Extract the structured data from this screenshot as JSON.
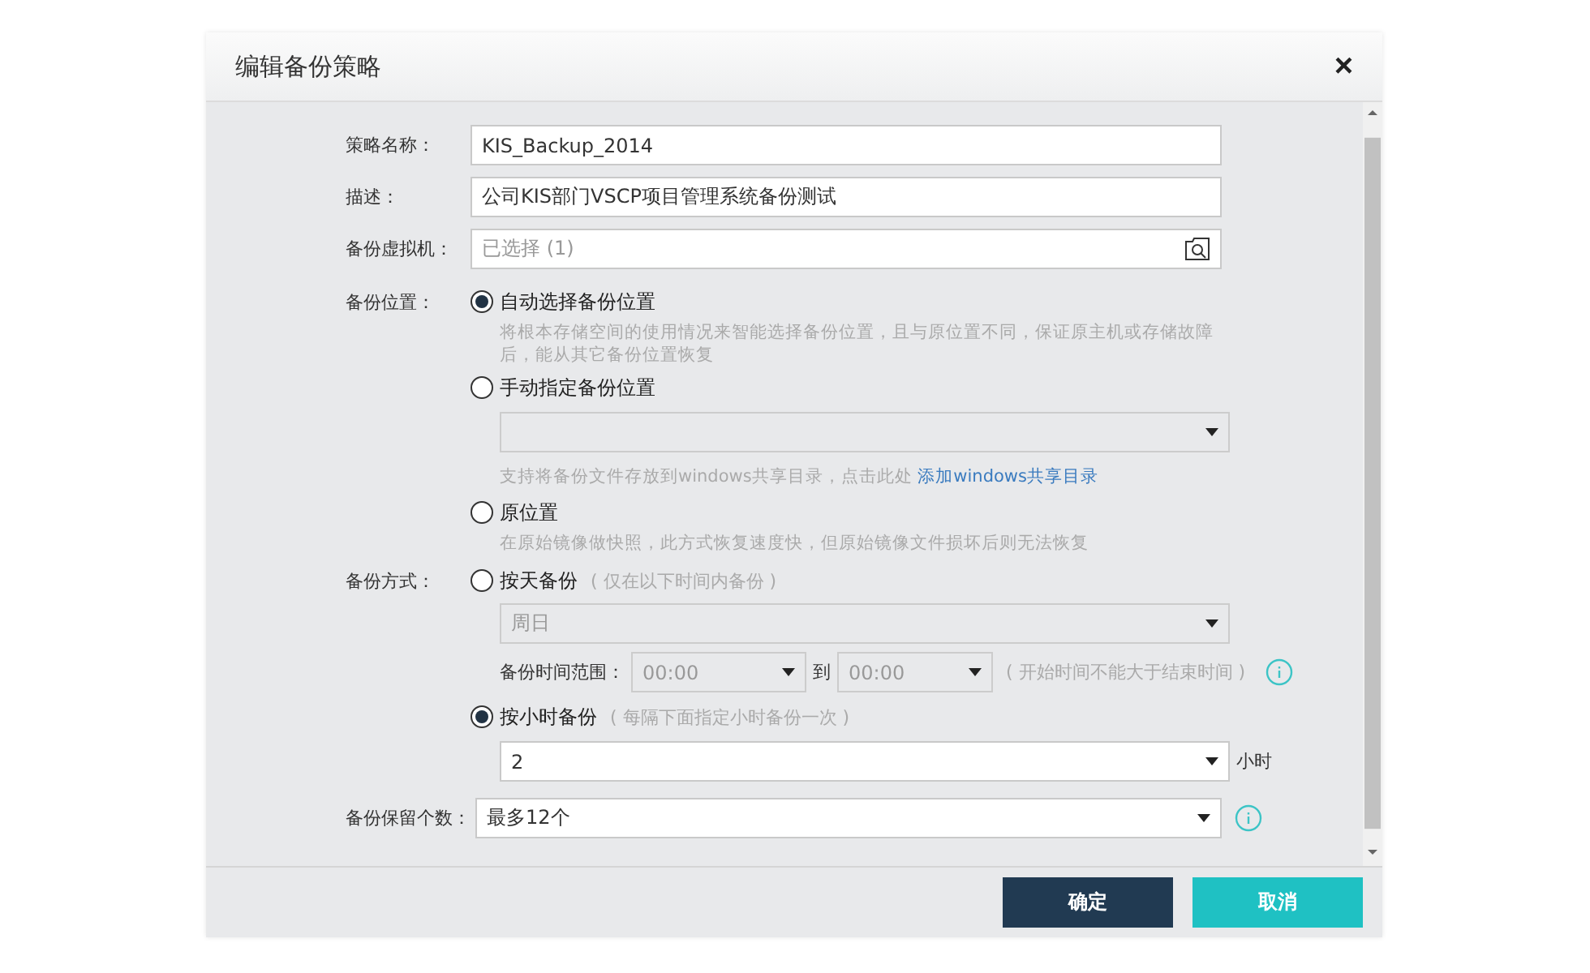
{
  "dialog": {
    "title": "编辑备份策略",
    "close": "×"
  },
  "fields": [
    {
      "kind": "text",
      "label": "策略名称：",
      "value": "KIS_Backup_2014"
    },
    {
      "kind": "text",
      "label": "描述：",
      "value": "公司KIS部门VSCP项目管理系统备份测试"
    },
    {
      "kind": "picker",
      "label": "备份虚拟机：",
      "placeholder": "已选择 (1)"
    }
  ],
  "location": {
    "label": "备份位置：",
    "options": [
      {
        "kind": "plain",
        "label": "自动选择备份位置",
        "selected": true,
        "hint": "将根本存储空间的使用情况来智能选择备份位置，且与原位置不同，保证原主机或存储故障后，能从其它备份位置恢复"
      },
      {
        "kind": "share",
        "label": "手动指定备份位置",
        "selected": false,
        "hint": "支持将备份文件存放到windows共享目录，点击此处",
        "link": "添加windows共享目录"
      },
      {
        "kind": "plain",
        "label": "原位置",
        "selected": false,
        "hint": "在原始镜像做快照，此方式恢复速度快，但原始镜像文件损坏后则无法恢复"
      }
    ]
  },
  "mode": {
    "label": "备份方式：",
    "options": [
      {
        "kind": "daily",
        "label": "按天备份",
        "note": "( 仅在以下时间内备份 )",
        "selected": false,
        "day": "周日",
        "range_label": "备份时间范围：",
        "from": "00:00",
        "to_label": "到",
        "to": "00:00",
        "range_note": "( 开始时间不能大于结束时间 )"
      },
      {
        "kind": "hourly",
        "label": "按小时备份",
        "note": "( 每隔下面指定小时备份一次 )",
        "selected": true,
        "hours": "2",
        "unit": "小时"
      }
    ]
  },
  "retention": {
    "label": "备份保留个数：",
    "value": "最多12个"
  },
  "buttons": [
    {
      "kind": "primary",
      "label": "确定"
    },
    {
      "kind": "secondary",
      "label": "取消"
    }
  ]
}
